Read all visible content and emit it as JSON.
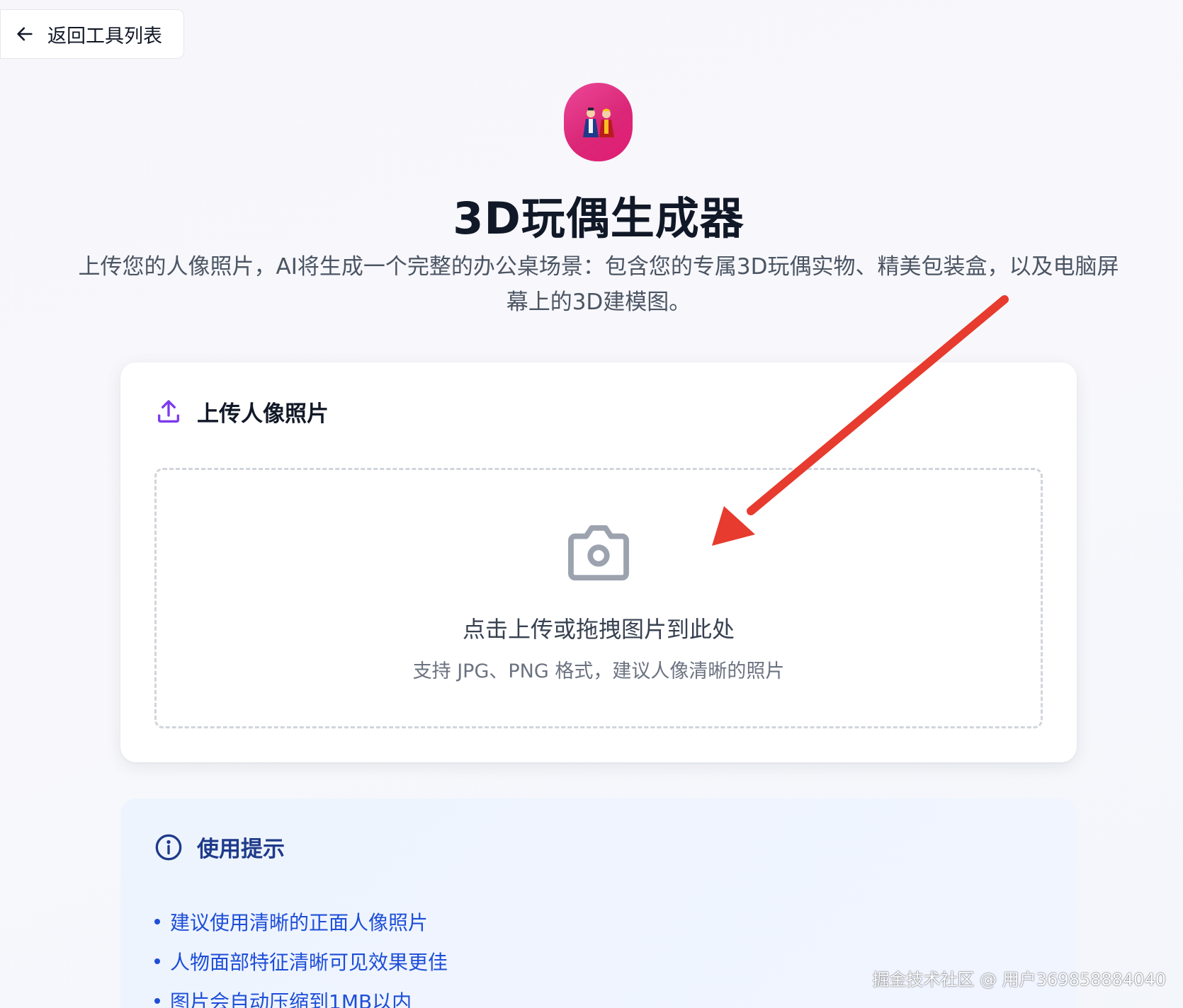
{
  "nav": {
    "back_label": "返回工具列表"
  },
  "hero": {
    "logo_emoji": "🎎",
    "title": "3D玩偶生成器",
    "subtitle": "上传您的人像照片，AI将生成一个完整的办公桌场景：包含您的专属3D玩偶实物、精美包装盒，以及电脑屏幕上的3D建模图。"
  },
  "upload": {
    "title": "上传人像照片",
    "drop_text": "点击上传或拖拽图片到此处",
    "drop_hint": "支持 JPG、PNG 格式，建议人像清晰的照片"
  },
  "tips": {
    "title": "使用提示",
    "items": [
      "建议使用清晰的正面人像照片",
      "人物面部特征清晰可见效果更佳",
      "图片会自动压缩到1MB以内"
    ]
  },
  "watermark": "掘金技术社区 @ 用户369858884040",
  "colors": {
    "accent_purple": "#7c3aed",
    "tips_blue": "#1d4ed8",
    "logo_pink": "#ec4899",
    "annotation_red": "#e63b2e"
  }
}
